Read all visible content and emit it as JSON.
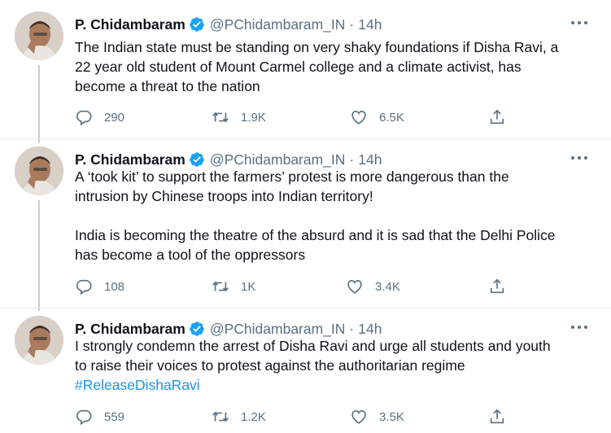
{
  "author": {
    "name": "P. Chidambaram",
    "handle": "@PChidambaram_IN",
    "separator": "·"
  },
  "tweets": [
    {
      "time": "14h",
      "lines": [
        "The Indian state must be standing on very shaky foundations if Disha Ravi, a",
        "22 year old student of Mount Carmel college and a climate activist, has",
        "become a threat to the nation"
      ],
      "replies": "290",
      "retweets": "1.9K",
      "likes": "6.5K"
    },
    {
      "time": "14h",
      "lines": [
        "A ‘took kit’ to support the farmers’ protest is more dangerous than the",
        "intrusion by Chinese troops into Indian territory!"
      ],
      "lines2": [
        "India is becoming the theatre of the absurd and it is sad that the Delhi Police",
        "has become a tool of the oppressors"
      ],
      "replies": "108",
      "retweets": "1K",
      "likes": "3.4K"
    },
    {
      "time": "14h",
      "lines": [
        "I strongly condemn the arrest of Disha Ravi and urge all students and youth",
        "to raise their voices to protest against the authoritarian regime"
      ],
      "hashtag": "#ReleaseDishaRavi",
      "replies": "559",
      "retweets": "1.2K",
      "likes": "3.5K"
    }
  ],
  "icons": {
    "verified": "verified-badge-icon",
    "more": "more-options-icon",
    "reply": "reply-icon",
    "retweet": "retweet-icon",
    "like": "like-icon",
    "share": "share-icon"
  },
  "colors": {
    "verified": "#1da1f2",
    "hashtag": "#1b95e0",
    "muted": "#5b7083",
    "thread_line": "#c4cfd6"
  }
}
